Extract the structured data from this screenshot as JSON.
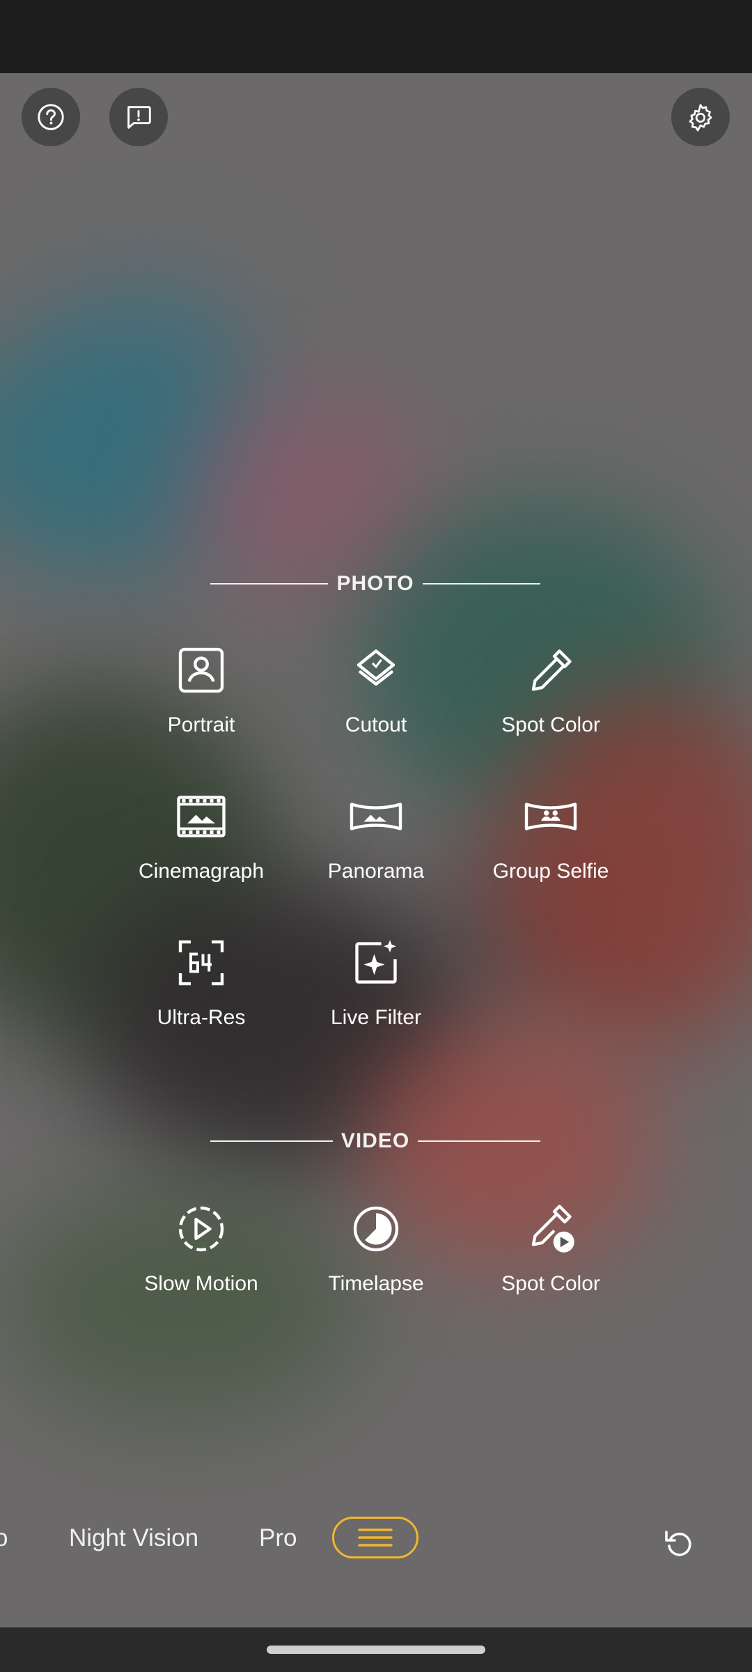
{
  "top_controls": {
    "help_icon": "help-circle-icon",
    "feedback_icon": "feedback-icon",
    "settings_icon": "gear-icon"
  },
  "photo_section": {
    "title": "PHOTO",
    "modes": [
      {
        "label": "Portrait",
        "icon": "portrait-icon"
      },
      {
        "label": "Cutout",
        "icon": "cutout-layers-icon"
      },
      {
        "label": "Spot Color",
        "icon": "eyedropper-icon"
      },
      {
        "label": "Cinemagraph",
        "icon": "filmstrip-icon"
      },
      {
        "label": "Panorama",
        "icon": "panorama-icon"
      },
      {
        "label": "Group Selfie",
        "icon": "group-selfie-icon"
      },
      {
        "label": "Ultra-Res",
        "icon": "ultra-res-64-icon"
      },
      {
        "label": "Live Filter",
        "icon": "live-filter-sparkle-icon"
      }
    ]
  },
  "video_section": {
    "title": "VIDEO",
    "modes": [
      {
        "label": "Slow Motion",
        "icon": "slow-motion-play-icon"
      },
      {
        "label": "Timelapse",
        "icon": "timelapse-icon"
      },
      {
        "label": "Spot Color",
        "icon": "eyedropper-video-icon"
      }
    ]
  },
  "mode_strip": {
    "partial_left": "o",
    "items": [
      "Night Vision",
      "Pro"
    ],
    "menu_icon": "hamburger-menu-icon",
    "rotate_icon": "rotate-reset-icon",
    "accent_color": "#f1b82d"
  }
}
